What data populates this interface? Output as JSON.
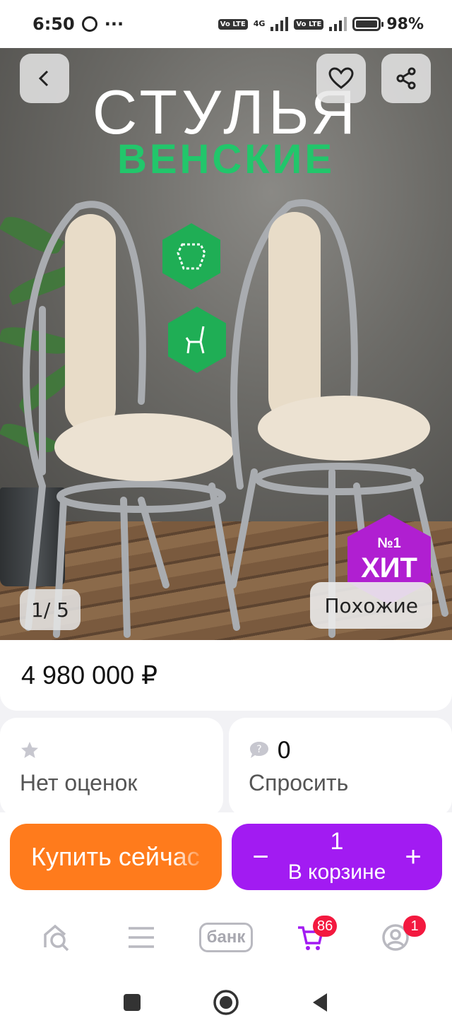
{
  "status_bar": {
    "time": "6:50",
    "dots": "···",
    "net_label": "4G",
    "volte_1": "Vo LTE",
    "volte_2": "Vo LTE",
    "battery": "98%"
  },
  "hero": {
    "title_line1": "СТУЛЬЯ",
    "title_line2": "ВЕНСКИЕ",
    "badge_no": "№1",
    "badge_hit": "ХИТ",
    "pager": "1/ 5",
    "similar_label": "Похожие",
    "colors": {
      "accent_green": "#22c66b",
      "badge_purple": "#b01fd1"
    }
  },
  "product": {
    "price": "4 980 000 ₽",
    "rating_count_label": "Нет оценок",
    "questions_count": "0",
    "ask_label": "Спросить"
  },
  "actions": {
    "buy_now": "Купить сейчас",
    "cart_qty": "1",
    "minus": "−",
    "plus": "+",
    "in_cart": "В корзине",
    "colors": {
      "buy": "#ff7b1c",
      "cart": "#a21bf2"
    }
  },
  "bottom_nav": {
    "bank_label": "банк",
    "cart_badge": "86",
    "profile_badge": "1",
    "icons": [
      "search-home-icon",
      "menu-icon",
      "bank-icon",
      "cart-icon",
      "profile-icon"
    ]
  }
}
